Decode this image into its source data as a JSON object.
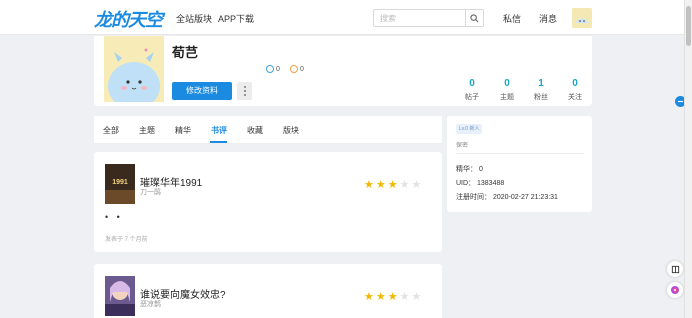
{
  "header": {
    "logo": "龙的天空",
    "nav": [
      "全站版块",
      "APP下载"
    ],
    "search_placeholder": "搜索",
    "right_links": [
      "私信",
      "消息"
    ]
  },
  "profile": {
    "name": "荀芑",
    "coins": [
      "0",
      "0"
    ],
    "edit_button": "修改资料",
    "stats": [
      {
        "value": "0",
        "label": "帖子"
      },
      {
        "value": "0",
        "label": "主题"
      },
      {
        "value": "1",
        "label": "粉丝"
      },
      {
        "value": "0",
        "label": "关注"
      }
    ]
  },
  "tabs": [
    {
      "label": "全部",
      "active": false
    },
    {
      "label": "主题",
      "active": false
    },
    {
      "label": "精华",
      "active": false
    },
    {
      "label": "书评",
      "active": true
    },
    {
      "label": "收藏",
      "active": false
    },
    {
      "label": "版块",
      "active": false
    }
  ],
  "side": {
    "badge": "Lv.0 新人",
    "gender": "保密",
    "rows": [
      "精华： 0",
      "UID：  1383488",
      "注册时间：  2020-02-27 21:23:31"
    ]
  },
  "reviews": [
    {
      "title": "璀璨华年1991",
      "author": "刀一鹃",
      "stars": 3,
      "body": "• •",
      "time": "发表于 7 个月前",
      "cover_text": "1991"
    },
    {
      "title": "谁说要向魔女效忠?",
      "author": "恶凉鹊",
      "stars": 3
    }
  ],
  "colors": {
    "accent": "#1a8be0",
    "stat": "#1aa6c9",
    "star": "#f5b800"
  }
}
